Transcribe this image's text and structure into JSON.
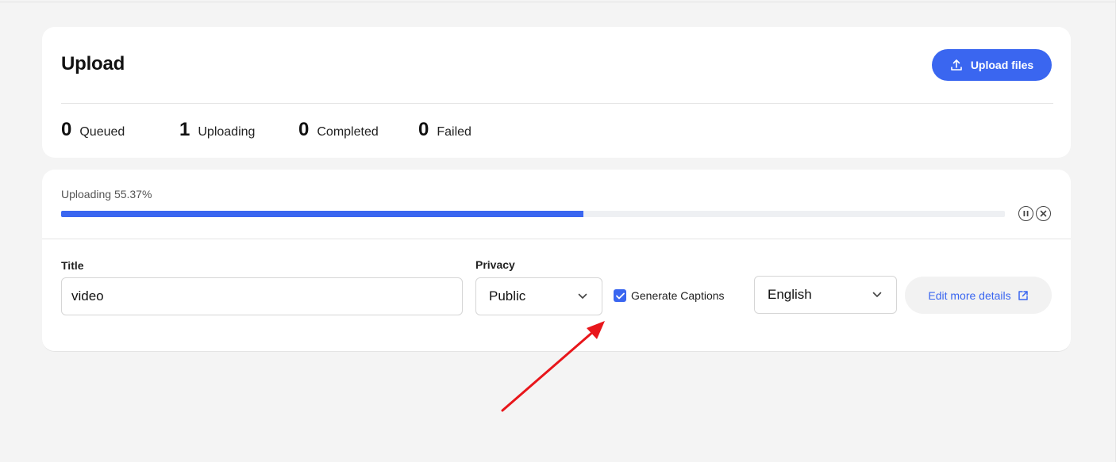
{
  "header": {
    "title": "Upload",
    "upload_button_label": "Upload files"
  },
  "stats": [
    {
      "count": "0",
      "label": "Queued"
    },
    {
      "count": "1",
      "label": "Uploading"
    },
    {
      "count": "0",
      "label": "Completed"
    },
    {
      "count": "0",
      "label": "Failed"
    }
  ],
  "upload_item": {
    "status_text": "Uploading 55.37%",
    "progress_percent": 55.37,
    "title_label": "Title",
    "title_value": "video",
    "privacy_label": "Privacy",
    "privacy_value": "Public",
    "captions_label": "Generate Captions",
    "captions_checked": true,
    "language_value": "English",
    "edit_details_label": "Edit more details"
  },
  "colors": {
    "accent": "#3a66f0",
    "annotation_arrow": "#e8161b"
  },
  "icons": {
    "upload": "upload-icon",
    "pause": "pause-icon",
    "cancel": "cancel-icon",
    "chevron": "chevron-down-icon",
    "external": "external-link-icon"
  }
}
